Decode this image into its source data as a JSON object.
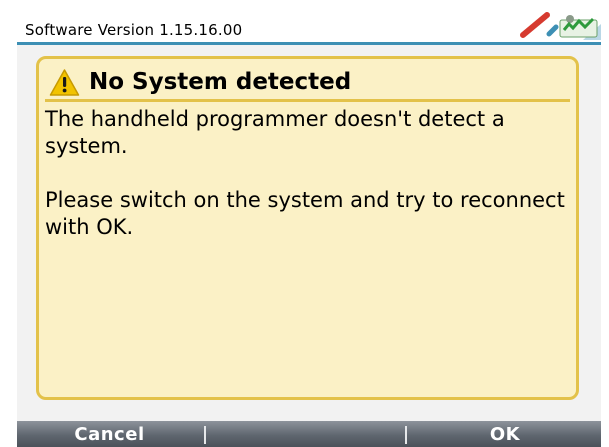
{
  "header": {
    "title": "Software Version 1.15.16.00",
    "status_icon": "connection-status-icon"
  },
  "dialog": {
    "icon": "warning-icon",
    "title": "No System detected",
    "paragraphs": [
      "The handheld programmer doesn't detect a system.",
      "Please switch on the system and try to reconnect with OK."
    ]
  },
  "softkeys": {
    "left_label": "Cancel",
    "middle_label": "",
    "right_label": "OK"
  },
  "colors": {
    "header_rule": "#3d8fb4",
    "panel_background": "#fbf1c6",
    "panel_border": "#e3c24a",
    "softkey_bar": "#5f666f",
    "warning_icon": "#f2c300",
    "status_icon_red": "#d63a2f",
    "status_icon_green": "#2e9a3c"
  }
}
